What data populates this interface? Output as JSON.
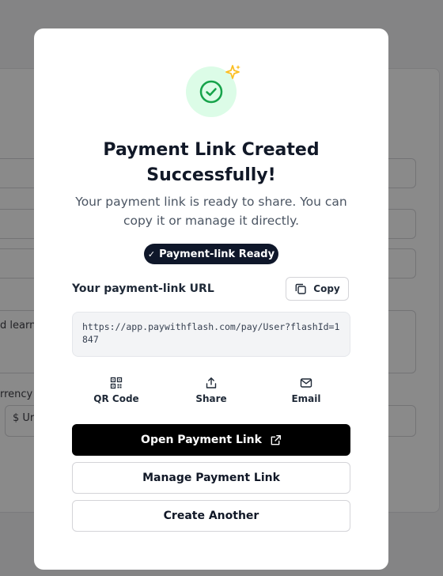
{
  "background": {
    "field_text_1": "d learni",
    "currency_label": "rrency",
    "currency_value": "$ Ur"
  },
  "modal": {
    "title": "Payment Link Created Successfully!",
    "subtitle": "Your payment link is ready to share. You can copy it or manage it directly.",
    "status_pill": "Payment-link Ready",
    "url_label": "Your payment-link URL",
    "copy_label": "Copy",
    "url": "https://app.paywithflash.com/pay/User?flashId=1847",
    "share_actions": [
      {
        "label": "QR Code",
        "icon": "qr-code-icon"
      },
      {
        "label": "Share",
        "icon": "share-icon"
      },
      {
        "label": "Email",
        "icon": "mail-icon"
      }
    ],
    "open_link_label": "Open Payment Link",
    "manage_link_label": "Manage Payment Link",
    "create_another_label": "Create Another"
  },
  "colors": {
    "success_bg": "#dcfce7",
    "success_fg": "#16a34a",
    "sparkle": "#fbbf24",
    "pill_bg": "#0f172a",
    "primary_button": "#000000"
  }
}
